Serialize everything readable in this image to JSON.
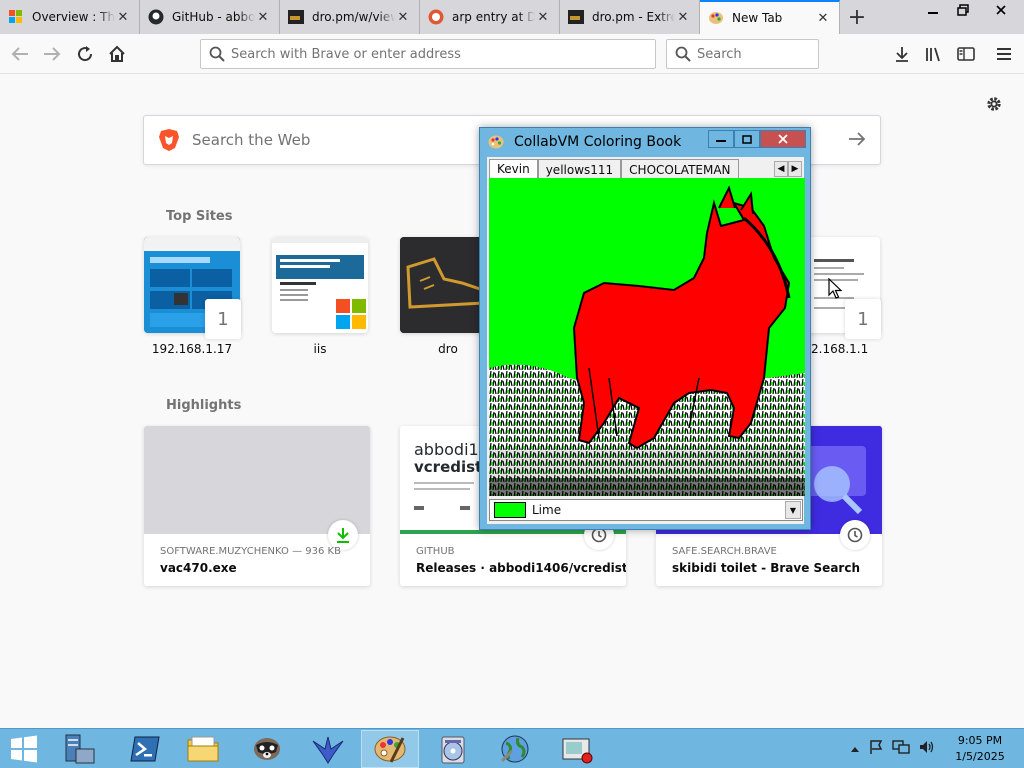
{
  "tabs": [
    {
      "title": "Overview : The",
      "icon": "windows-logo-icon",
      "active": false
    },
    {
      "title": "GitHub - abbo",
      "icon": "github-icon",
      "active": false
    },
    {
      "title": "dro.pm/w/view",
      "icon": "dro-favicon-icon",
      "active": false
    },
    {
      "title": "arp entry at Du",
      "icon": "duckduckgo-icon",
      "active": false
    },
    {
      "title": "dro.pm - Extre",
      "icon": "dro-favicon-icon",
      "active": false
    },
    {
      "title": "New Tab",
      "icon": "brave-paint-icon",
      "active": true
    }
  ],
  "urlbar": {
    "placeholder": "Search with Brave or enter address"
  },
  "searchbar": {
    "placeholder": "Search"
  },
  "websearch": {
    "placeholder": "Search the Web"
  },
  "top_sites": {
    "heading": "Top Sites",
    "items": [
      {
        "label": "192.168.1.17",
        "badge": "1"
      },
      {
        "label": "iis",
        "badge": ""
      },
      {
        "label": "dro",
        "badge": ""
      },
      {
        "label": "192.168.1.1",
        "badge": "1"
      }
    ]
  },
  "highlights": {
    "heading": "Highlights",
    "items": [
      {
        "source": "SOFTWARE.MUZYCHENKO — 936 KB",
        "title": "vac470.exe",
        "icon": "download-icon"
      },
      {
        "source": "GITHUB",
        "title": "Releases · abbodi1406/vcredist",
        "icon": "clock-icon",
        "thumb_heading": "abbodi14",
        "thumb_title": "vcredist"
      },
      {
        "source": "SAFE.SEARCH.BRAVE",
        "title": "skibidi toilet - Brave Search",
        "icon": "clock-icon"
      }
    ]
  },
  "collabvm": {
    "title": "CollabVM Coloring Book",
    "tabs": [
      "Kevin",
      "yellows111",
      "CHOCOLATEMAN"
    ],
    "active_tab": "Kevin",
    "selected_color": {
      "name": "Lime",
      "hex": "#00ff00"
    }
  },
  "taskbar": {
    "time": "9:05 PM",
    "date": "1/5/2025"
  },
  "colors": {
    "accent": "#0a84ff",
    "taskbar": "#6fb7e0",
    "horse": "#ff0000",
    "grass": "#00ff00"
  }
}
